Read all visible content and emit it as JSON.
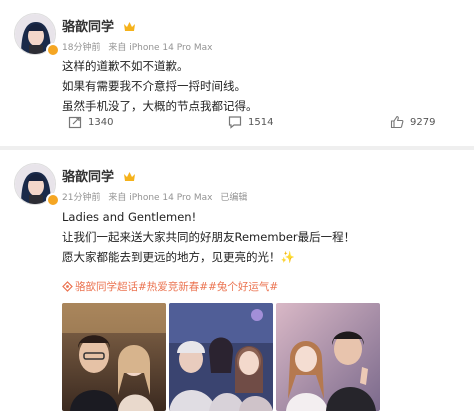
{
  "posts": [
    {
      "user": {
        "name": "骆歆同学",
        "avatar_icon": "user-avatar-icon",
        "badge_icon": "verified-badge-icon",
        "crown_icon": "crown-icon"
      },
      "meta": {
        "time": "18分钟前",
        "source": "来自 iPhone 14 Pro Max",
        "edited": ""
      },
      "lines": [
        "这样的道歉不如不道歉。",
        "如果有需要我不介意捋一捋时间线。",
        "虽然手机没了，大概的节点我都记得。"
      ],
      "actions": {
        "repost": "1340",
        "comment": "1514",
        "like": "9279"
      }
    },
    {
      "user": {
        "name": "骆歆同学",
        "avatar_icon": "user-avatar-icon",
        "badge_icon": "verified-badge-icon",
        "crown_icon": "crown-icon"
      },
      "meta": {
        "time": "21分钟前",
        "source": "来自 iPhone 14 Pro Max",
        "edited": "已编辑"
      },
      "lines": [
        "Ladies and Gentlemen!",
        "让我们一起来送大家共同的好朋友Remember最后一程！",
        "愿大家都能去到更远的地方，见更亮的光！✨"
      ],
      "topics": "骆歆同学超话#热爱竞新春##兔个好运气#",
      "photos": [
        {
          "icon": "photo-two-people-icon"
        },
        {
          "icon": "photo-group-icon"
        },
        {
          "icon": "photo-two-people-icon"
        }
      ]
    }
  ],
  "colors": {
    "accent": "#eb7350",
    "meta": "#939393",
    "badge": "#f5a623"
  }
}
